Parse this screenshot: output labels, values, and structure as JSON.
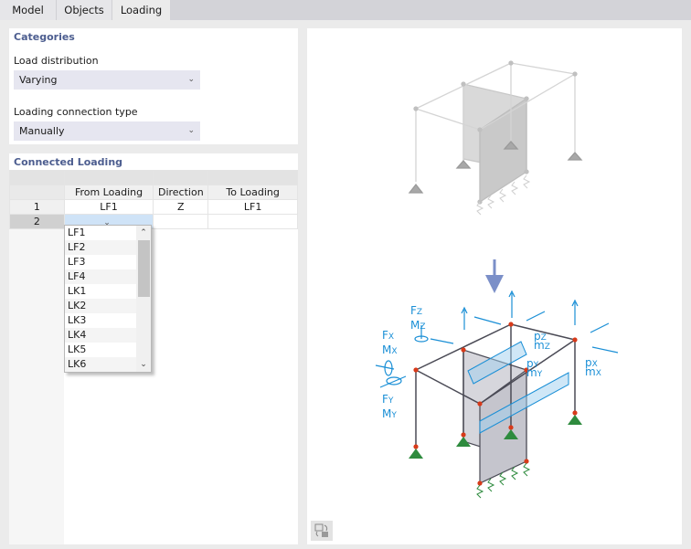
{
  "tabs": [
    {
      "label": "Model",
      "active": false
    },
    {
      "label": "Objects",
      "active": false
    },
    {
      "label": "Loading",
      "active": true
    }
  ],
  "categories": {
    "title": "Categories",
    "load_distribution": {
      "label": "Load distribution",
      "value": "Varying"
    },
    "connection_type": {
      "label": "Loading connection type",
      "value": "Manually"
    }
  },
  "connected_loading": {
    "title": "Connected Loading",
    "columns": [
      "From Loading",
      "Direction",
      "To Loading"
    ],
    "rows": [
      {
        "num": "1",
        "from": "LF1",
        "direction": "Z",
        "to": "LF1"
      },
      {
        "num": "2",
        "from": "",
        "direction": "",
        "to": ""
      }
    ],
    "dropdown_options": [
      "LF1",
      "LF2",
      "LF3",
      "LF4",
      "LK1",
      "LK2",
      "LK3",
      "LK4",
      "LK5",
      "LK6"
    ]
  },
  "diagram": {
    "labels": {
      "fz": "F",
      "fz_sub": "Z",
      "mz": "M",
      "mz_sub": "Z",
      "fx": "F",
      "fx_sub": "X",
      "mx": "M",
      "mx_sub": "X",
      "fy": "F",
      "fy_sub": "Y",
      "my": "M",
      "my_sub": "Y",
      "pz": "p",
      "pz_sub": "Z",
      "mzl": "m",
      "mzl_sub": "Z",
      "py": "p",
      "py_sub": "Y",
      "myl": "m",
      "myl_sub": "Y",
      "px": "p",
      "px_sub": "X",
      "mxl": "m",
      "mxl_sub": "X"
    },
    "colors": {
      "load": "#1a8fd6",
      "frame": "#4a4a55",
      "node": "#d83a1a",
      "support": "#2e8b3e",
      "main_arrow": "#7b8fc8"
    }
  },
  "viewport": {
    "toggle_button_icon": "view-toggle-icon"
  }
}
